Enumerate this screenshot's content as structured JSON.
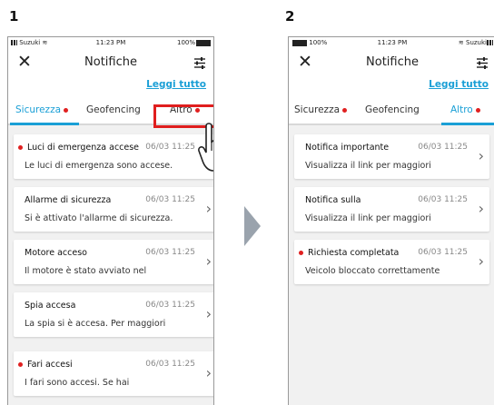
{
  "steps": {
    "one": "1",
    "two": "2"
  },
  "screen1": {
    "status": {
      "carrier": "Suzuki",
      "time": "11:23 PM",
      "battery": "100%"
    },
    "title": "Notifiche",
    "read_all": "Leggi tutto",
    "tabs": [
      {
        "label": "Sicurezza",
        "dot": true,
        "active": true
      },
      {
        "label": "Geofencing",
        "dot": false,
        "active": false
      },
      {
        "label": "Altro",
        "dot": true,
        "active": false
      }
    ],
    "cards": [
      {
        "title": "Luci di emergenza accese",
        "date": "06/03 11:25",
        "body": "Le luci di emergenza sono accese.",
        "unread": true
      },
      {
        "title": "Allarme di sicurezza",
        "date": "06/03 11:25",
        "body": "Si è attivato l'allarme di sicurezza.",
        "unread": false
      },
      {
        "title": "Motore acceso",
        "date": "06/03 11:25",
        "body": "Il motore è stato avviato nel",
        "unread": false
      },
      {
        "title": "Spia accesa",
        "date": "06/03 11:25",
        "body": "La spia si è accesa. Per maggiori",
        "unread": false
      },
      {
        "title": "Fari accesi",
        "date": "06/03 11:25",
        "body": "I fari sono accesi. Se hai",
        "unread": true
      }
    ]
  },
  "screen2": {
    "status": {
      "carrier": "Suzuki",
      "time": "11:23 PM",
      "battery": "100%"
    },
    "title": "Notifiche",
    "read_all": "Leggi tutto",
    "tabs": [
      {
        "label": "Sicurezza",
        "dot": true,
        "active": false
      },
      {
        "label": "Geofencing",
        "dot": false,
        "active": false
      },
      {
        "label": "Altro",
        "dot": true,
        "active": true
      }
    ],
    "cards": [
      {
        "title": "Notifica importante",
        "date": "06/03 11:25",
        "body": "Visualizza il link per maggiori",
        "unread": false
      },
      {
        "title": "Notifica sulla",
        "date": "06/03 11:25",
        "body": "Visualizza il link per maggiori",
        "unread": false
      },
      {
        "title": "Richiesta completata",
        "date": "06/03 11:25",
        "body": "Veicolo bloccato correttamente",
        "unread": true
      }
    ]
  },
  "colors": {
    "accent": "#1a9fd6",
    "dot": "#e02020",
    "highlight": "#e01e1e"
  },
  "icons": {
    "close": "close-icon",
    "filter": "filter-sliders-icon",
    "chevron": "chevron-right-icon",
    "hand": "tap-hand-icon",
    "arrow": "next-step-arrow-icon"
  }
}
